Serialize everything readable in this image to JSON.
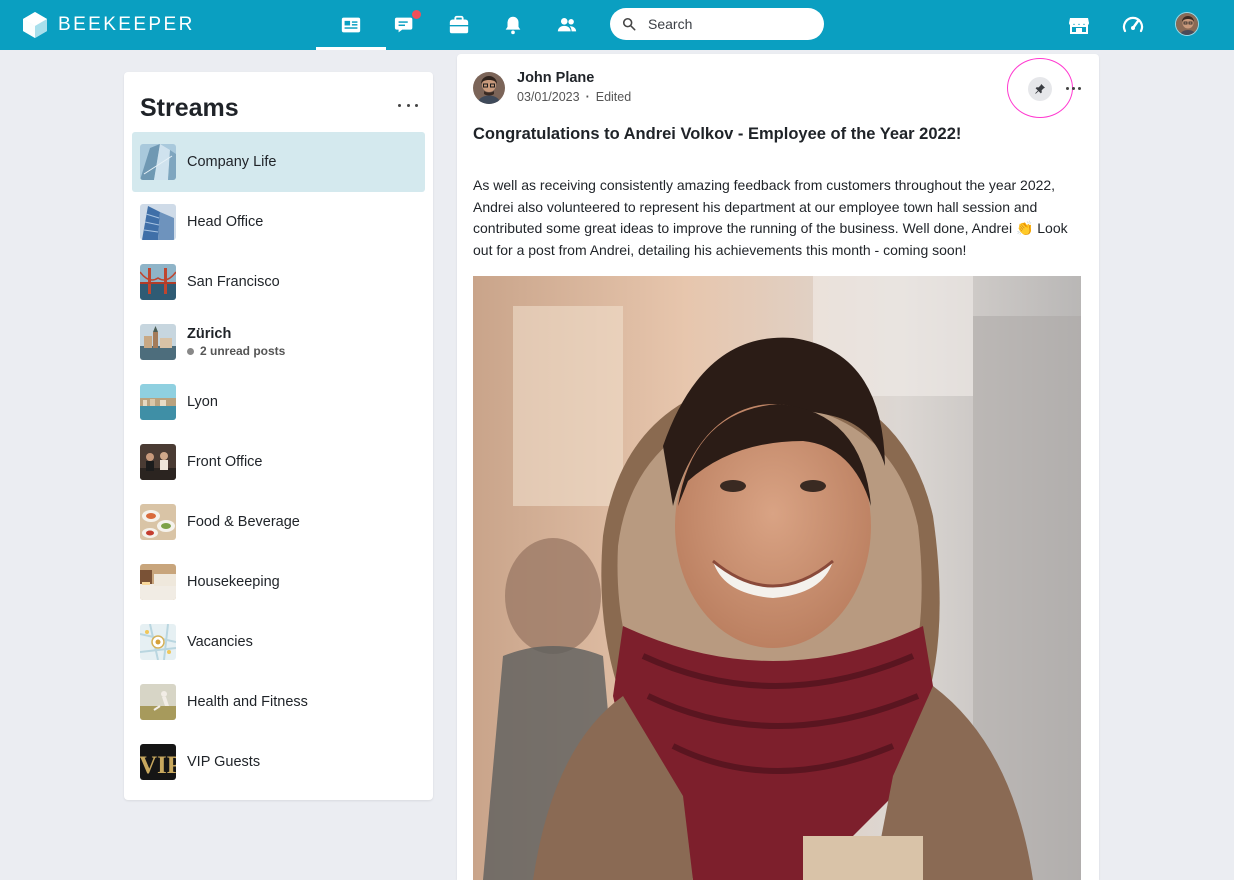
{
  "app": {
    "name": "BEEKEEPER"
  },
  "topbar": {
    "nav": [
      {
        "icon": "news-feed-icon",
        "active": true
      },
      {
        "icon": "chat-icon",
        "has_badge": true
      },
      {
        "icon": "toolbox-icon"
      },
      {
        "icon": "bell-icon"
      },
      {
        "icon": "people-icon"
      }
    ],
    "search_placeholder": "Search",
    "right_icons": [
      "store-icon",
      "dashboard-gauge-icon",
      "user-avatar"
    ]
  },
  "streams": {
    "title": "Streams",
    "items": [
      {
        "name": "Company Life",
        "selected": true
      },
      {
        "name": "Head Office"
      },
      {
        "name": "San Francisco"
      },
      {
        "name": "Zürich",
        "bold": true,
        "unread": "2 unread posts"
      },
      {
        "name": "Lyon"
      },
      {
        "name": "Front Office"
      },
      {
        "name": "Food & Beverage"
      },
      {
        "name": "Housekeeping"
      },
      {
        "name": "Vacancies"
      },
      {
        "name": "Health and Fitness"
      },
      {
        "name": "VIP Guests"
      }
    ]
  },
  "post": {
    "author": "John Plane",
    "date": "03/01/2023",
    "edited": "Edited",
    "title": "Congratulations to Andrei Volkov - Employee of the Year 2022!",
    "body": "As well as receiving consistently amazing feedback from customers throughout the year 2022, Andrei also volunteered to represent his department at our employee town hall session and contributed some great ideas to improve the running of the business. Well done, Andrei 👏 Look out for a post from Andrei, detailing his achievements this month - coming soon!"
  },
  "colors": {
    "brand": "#0a9fc1",
    "selected_stream": "#d4e9ee",
    "badge": "#f0505a",
    "highlight_ring": "#ff3ad0"
  }
}
